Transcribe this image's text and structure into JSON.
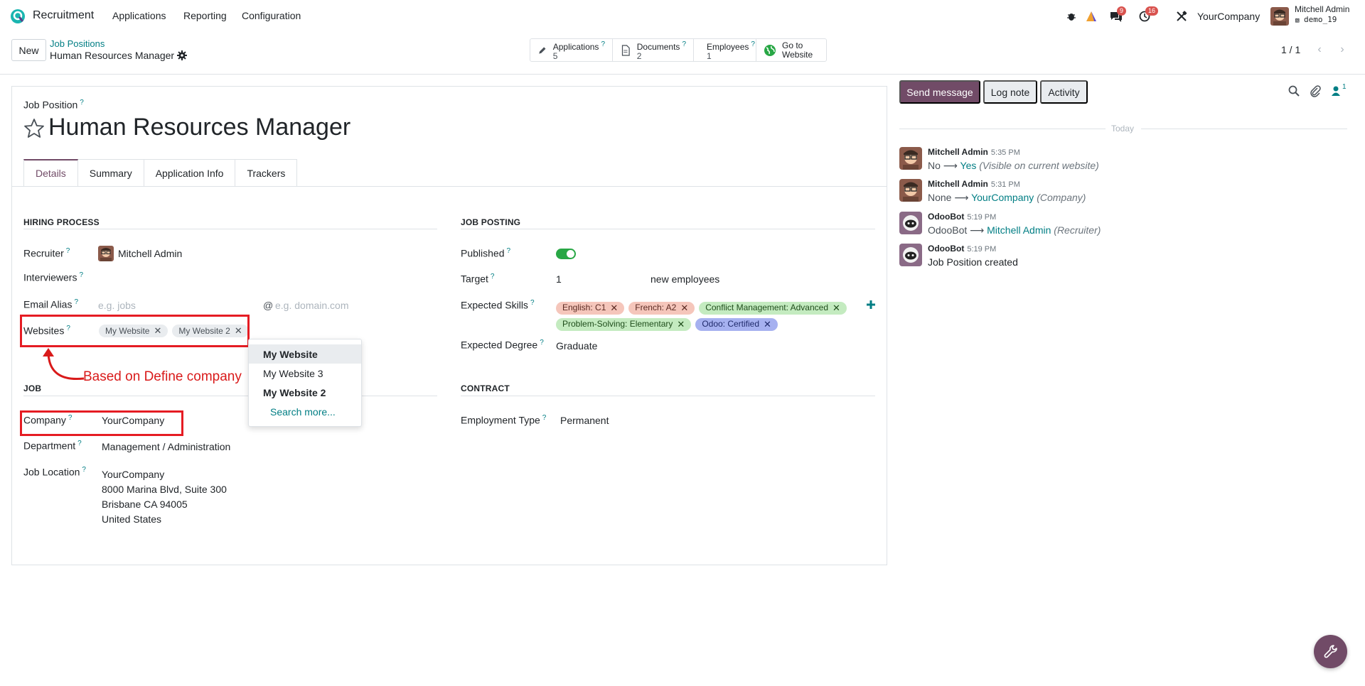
{
  "app": {
    "name": "Recruitment",
    "menu": [
      "Applications",
      "Reporting",
      "Configuration"
    ]
  },
  "systray": {
    "messages_count": "9",
    "activities_count": "16",
    "company": "YourCompany",
    "user_name": "Mitchell Admin",
    "database": "demo_19"
  },
  "control_panel": {
    "new_label": "New",
    "breadcrumb_parent": "Job Positions",
    "breadcrumb_current": "Human Resources Manager",
    "pager": "1 / 1"
  },
  "smart_buttons": [
    {
      "label": "Applications",
      "value": "5"
    },
    {
      "label": "Documents",
      "value": "2"
    },
    {
      "label": "Employees",
      "value": "1"
    },
    {
      "label": "Go to",
      "value": "Website"
    }
  ],
  "form": {
    "job_position_label": "Job Position",
    "title": "Human Resources Manager",
    "tabs": [
      "Details",
      "Summary",
      "Application Info",
      "Trackers"
    ],
    "hiring_process": {
      "section": "HIRING PROCESS",
      "recruiter_label": "Recruiter",
      "recruiter": "Mitchell Admin",
      "interviewers_label": "Interviewers",
      "email_alias_label": "Email Alias",
      "email_alias_placeholder": "e.g. jobs",
      "at_sign": "@",
      "domain_placeholder": "e.g. domain.com",
      "websites_label": "Websites",
      "websites": [
        "My Website",
        "My Website 2"
      ]
    },
    "job": {
      "section": "JOB",
      "company_label": "Company",
      "company": "YourCompany",
      "department_label": "Department",
      "department": "Management / Administration",
      "location_label": "Job Location",
      "location_lines": [
        "YourCompany",
        "8000 Marina Blvd, Suite 300",
        "Brisbane CA 94005",
        "United States"
      ]
    },
    "job_posting": {
      "section": "JOB POSTING",
      "published_label": "Published",
      "published": true,
      "target_label": "Target",
      "target": "1",
      "target_suffix": "new employees",
      "skills_label": "Expected Skills",
      "skills": [
        {
          "name": "English: C1",
          "color": "#f5c6bb"
        },
        {
          "name": "French: A2",
          "color": "#f5c6bb"
        },
        {
          "name": "Conflict Management: Advanced",
          "color": "#c4ebc0"
        },
        {
          "name": "Problem-Solving: Elementary",
          "color": "#c4ebc0"
        },
        {
          "name": "Odoo: Certified",
          "color": "#a6b1f0"
        }
      ],
      "degree_label": "Expected Degree",
      "degree": "Graduate"
    },
    "contract": {
      "section": "CONTRACT",
      "employment_type_label": "Employment Type",
      "employment_type": "Permanent"
    }
  },
  "dropdown": {
    "items": [
      "My Website",
      "My Website 3",
      "My Website 2"
    ],
    "search_more": "Search more..."
  },
  "annotation": "Based on Define company",
  "chatter": {
    "send_message": "Send message",
    "log_note": "Log note",
    "activity": "Activity",
    "followers_count": "1",
    "today": "Today",
    "messages": [
      {
        "author": "Mitchell Admin",
        "time": "5:35 PM",
        "old": "No",
        "new": "Yes",
        "note": "(Visible on current website)"
      },
      {
        "author": "Mitchell Admin",
        "time": "5:31 PM",
        "old": "None",
        "new": "YourCompany",
        "note": "(Company)"
      },
      {
        "author": "OdooBot",
        "time": "5:19 PM",
        "old": "OdooBot",
        "new": "Mitchell Admin",
        "note": "(Recruiter)"
      },
      {
        "author": "OdooBot",
        "time": "5:19 PM",
        "text": "Job Position created"
      }
    ]
  },
  "colors": {
    "primary": "#714b67",
    "link": "#017e84",
    "annotation_red": "#e51c23"
  }
}
